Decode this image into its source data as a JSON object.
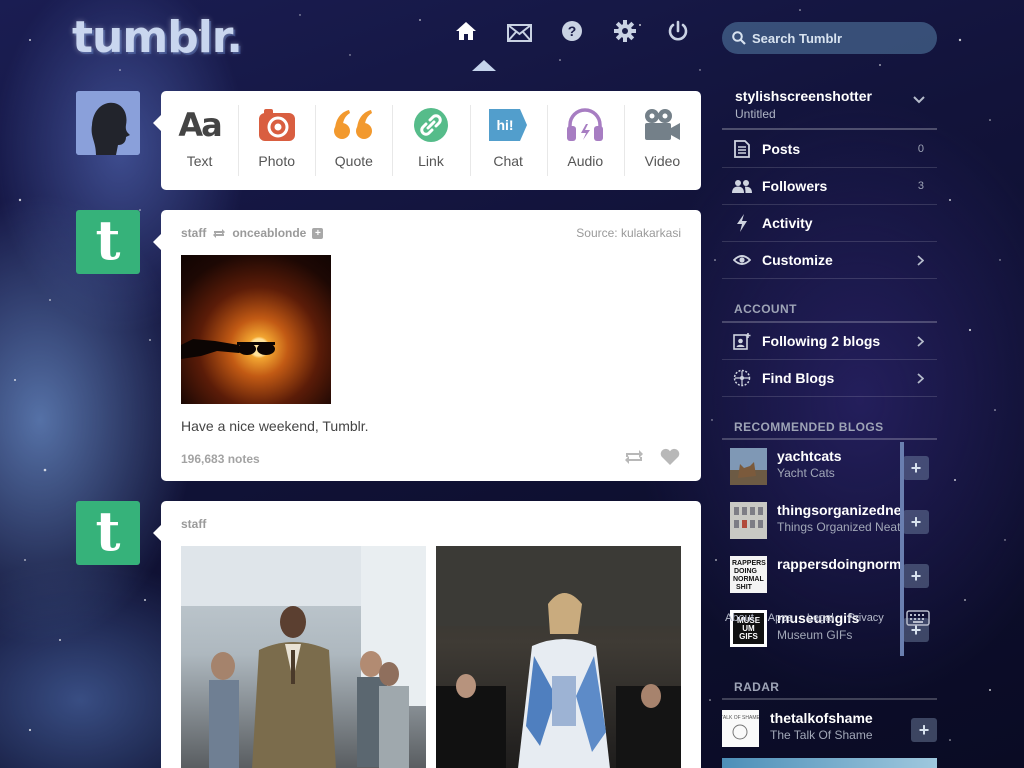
{
  "header": {
    "logo": "tumblr.",
    "nav": [
      {
        "name": "home-icon",
        "label": "Dashboard"
      },
      {
        "name": "envelope-icon",
        "label": "Messages"
      },
      {
        "name": "help-icon",
        "label": "Help"
      },
      {
        "name": "gear-icon",
        "label": "Settings"
      },
      {
        "name": "power-icon",
        "label": "Log out"
      }
    ],
    "search_placeholder": "Search Tumblr"
  },
  "composer": {
    "types": [
      {
        "key": "text",
        "label": "Text",
        "glyph": "Aa",
        "color": "#444444"
      },
      {
        "key": "photo",
        "label": "Photo",
        "color": "#d95e40"
      },
      {
        "key": "quote",
        "label": "Quote",
        "glyph": "“",
        "color": "#f2992e"
      },
      {
        "key": "link",
        "label": "Link",
        "color": "#56bc8a"
      },
      {
        "key": "chat",
        "label": "Chat",
        "glyph": "hi!",
        "color": "#529ecc"
      },
      {
        "key": "audio",
        "label": "Audio",
        "color": "#a77dc2"
      },
      {
        "key": "video",
        "label": "Video",
        "color": "#748089"
      }
    ]
  },
  "posts": [
    {
      "author": "staff",
      "reblogged_from": "onceablonde",
      "source_label": "Source:",
      "source": "kulakarkasi",
      "caption": "Have a nice weekend, Tumblr.",
      "notes": "196,683 notes"
    },
    {
      "author": "staff"
    }
  ],
  "avatar_letter": "t",
  "sidebar": {
    "blog_name": "stylishscreenshotter",
    "blog_subtitle": "Untitled",
    "items": [
      {
        "label": "Posts",
        "count": "0"
      },
      {
        "label": "Followers",
        "count": "3"
      },
      {
        "label": "Activity",
        "count": ""
      },
      {
        "label": "Customize",
        "count": ""
      }
    ],
    "account_heading": "ACCOUNT",
    "account_items": [
      {
        "label": "Following 2 blogs"
      },
      {
        "label": "Find Blogs"
      }
    ],
    "recommended_heading": "RECOMMENDED BLOGS",
    "recommended": [
      {
        "name": "yachtcats",
        "title": "Yacht Cats"
      },
      {
        "name": "thingsorganizedneatly",
        "title": "Things Organized Neatly"
      },
      {
        "name": "rappersdoingnormalshit",
        "title": ""
      },
      {
        "name": "museumgifs",
        "title": "Museum GIFs",
        "thumb_text": "MUSEUM GIFS"
      }
    ],
    "follow_label": "+",
    "radar_heading": "RADAR",
    "radar": {
      "name": "thetalkofshame",
      "title": "The Talk Of Shame"
    },
    "footer": [
      "About",
      "Apps",
      "Legal",
      "Privacy"
    ]
  }
}
